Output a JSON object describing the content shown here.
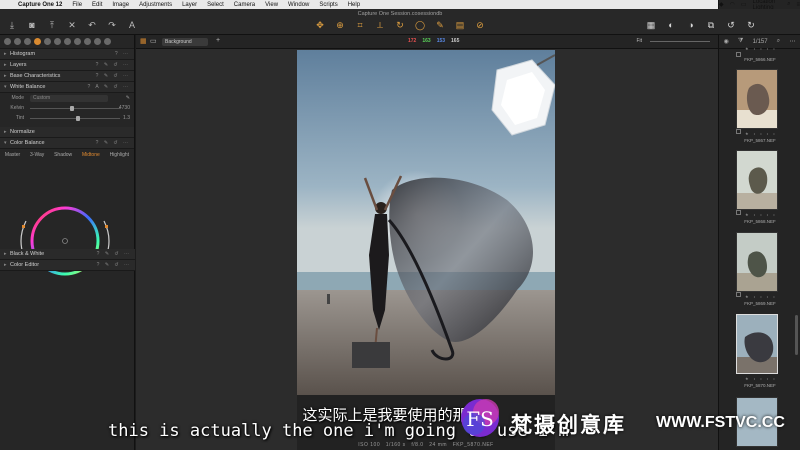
{
  "menubar": {
    "apple": "",
    "app_name": "Capture One 12",
    "items": [
      "File",
      "Edit",
      "Image",
      "Adjustments",
      "Layer",
      "Select",
      "Camera",
      "View",
      "Window",
      "Scripts",
      "Help"
    ],
    "status_right": "The Location Lighting Series"
  },
  "toolbar": {
    "session_title": "Capture One Session.cosessiondb"
  },
  "left_panel": {
    "panels": {
      "histogram": "Histogram",
      "layers": "Layers",
      "base_characteristics": "Base Characteristics",
      "white_balance": "White Balance",
      "normalize": "Normalize",
      "color_balance": "Color Balance",
      "black_white": "Black & White",
      "color_editor": "Color Editor"
    },
    "white_balance": {
      "mode_label": "Mode",
      "mode_value": "Custom",
      "kelvin_label": "Kelvin",
      "kelvin_value": "4730",
      "tint_label": "Tint",
      "tint_value": "1.3"
    },
    "color_balance": {
      "tabs": [
        "Master",
        "3-Way",
        "Shadow",
        "Midtone",
        "Highlight"
      ],
      "active_tab": "Midtone"
    }
  },
  "viewer": {
    "background_select": "Background",
    "rgb": {
      "r": "172",
      "g": "163",
      "b": "153",
      "l": "165"
    },
    "colors": {
      "r": "#e85050",
      "g": "#5ad25a",
      "b": "#5a8ae8",
      "l": "#cccccc"
    },
    "fit_label": "Fit",
    "meta": {
      "iso": "ISO 100",
      "shutter": "1/160 s",
      "aperture": "f/8.0",
      "focal": "24 mm",
      "filename": "FKP_5870.NEF"
    }
  },
  "browser": {
    "counter": "1/157",
    "thumbs": [
      {
        "name": "FKP_5866.NEF"
      },
      {
        "name": "FKP_5867.NEF"
      },
      {
        "name": "FKP_5868.NEF"
      },
      {
        "name": "FKP_5869.NEF"
      },
      {
        "name": "FKP_5870.NEF"
      }
    ]
  },
  "subtitles": {
    "chinese": "这实际上是我要使用的那颗，",
    "english": "this is actually the one i'm going to use i'm"
  },
  "watermark": {
    "logo_text": "FS",
    "name": "梵摄创意库",
    "url": "WWW.FSTVC.CC"
  }
}
